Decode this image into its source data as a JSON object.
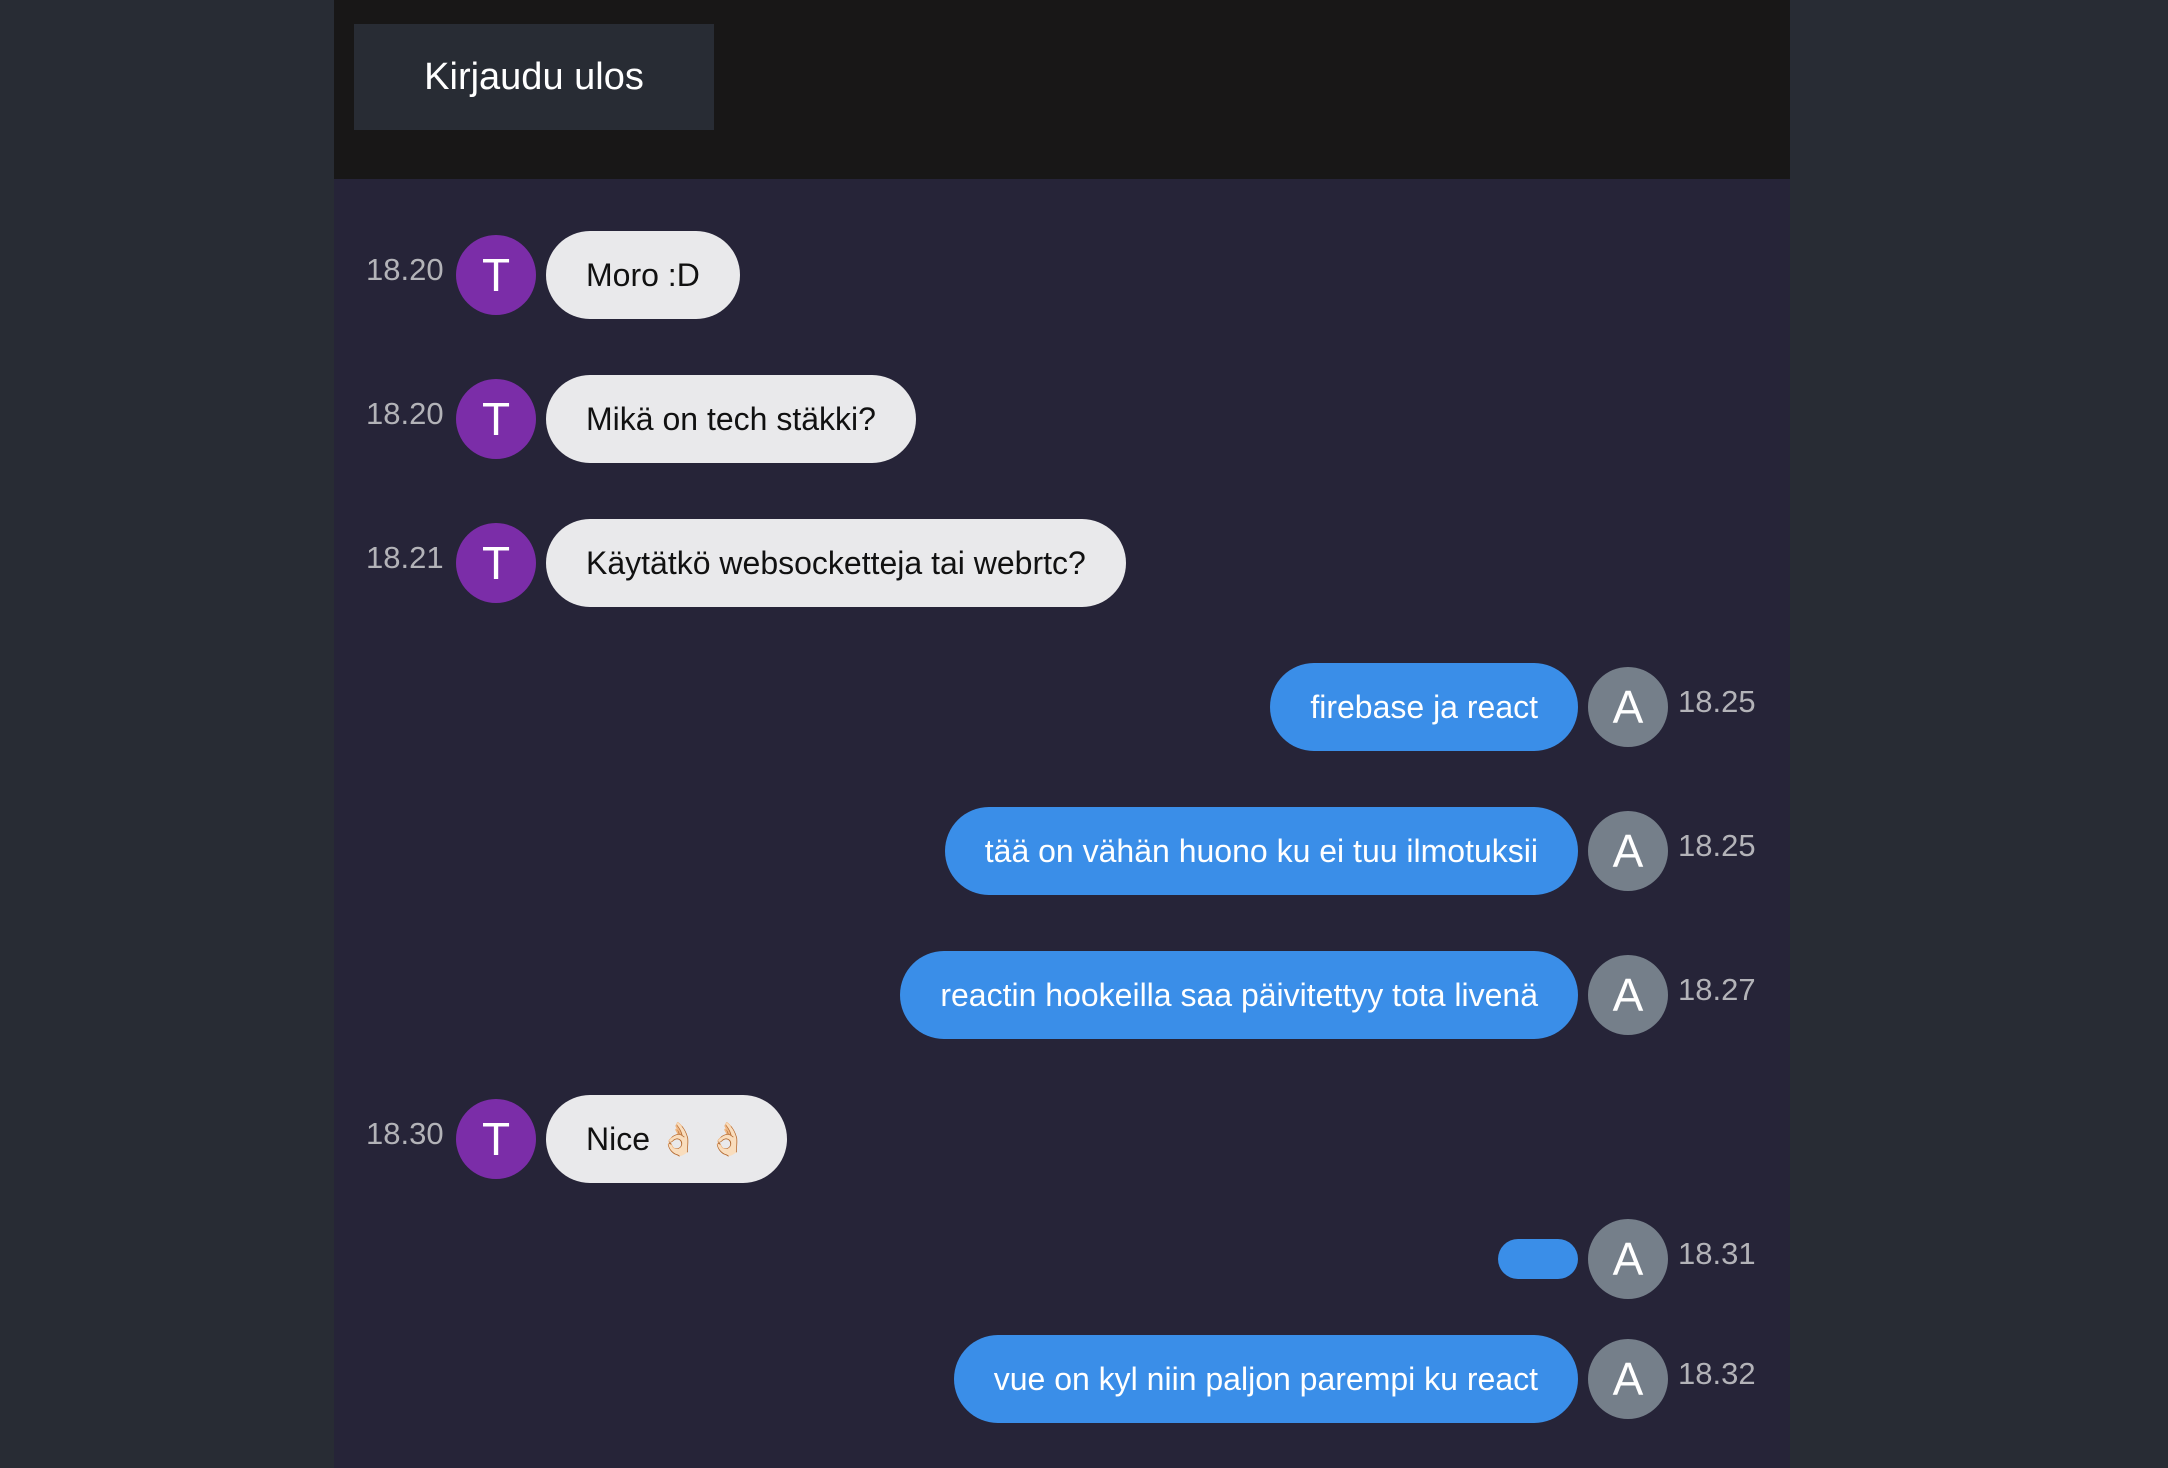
{
  "header": {
    "logout_label": "Kirjaudu ulos"
  },
  "colors": {
    "page_bg": "#282c34",
    "chat_bg": "#262438",
    "header_bg": "#181717",
    "incoming_bubble": "#e9e9eb",
    "outgoing_bubble": "#3a8ee8",
    "avatar_t": "#7b2da8",
    "avatar_a": "#757f8a"
  },
  "messages": [
    {
      "time": "18.20",
      "avatar": "T",
      "text": "Moro :D",
      "direction": "in"
    },
    {
      "time": "18.20",
      "avatar": "T",
      "text": "Mikä on tech stäkki?",
      "direction": "in"
    },
    {
      "time": "18.21",
      "avatar": "T",
      "text": "Käytätkö websocketteja tai webrtc?",
      "direction": "in"
    },
    {
      "time": "18.25",
      "avatar": "A",
      "text": "firebase ja react",
      "direction": "out"
    },
    {
      "time": "18.25",
      "avatar": "A",
      "text": "tää on vähän huono ku ei tuu ilmotuksii",
      "direction": "out"
    },
    {
      "time": "18.27",
      "avatar": "A",
      "text": "reactin hookeilla saa päivitettyy tota livenä",
      "direction": "out"
    },
    {
      "time": "18.30",
      "avatar": "T",
      "text": "Nice 👌🏻 👌🏻",
      "direction": "in"
    },
    {
      "time": "18.31",
      "avatar": "A",
      "text": "",
      "direction": "out"
    },
    {
      "time": "18.32",
      "avatar": "A",
      "text": "vue on kyl niin paljon parempi ku react",
      "direction": "out"
    }
  ]
}
